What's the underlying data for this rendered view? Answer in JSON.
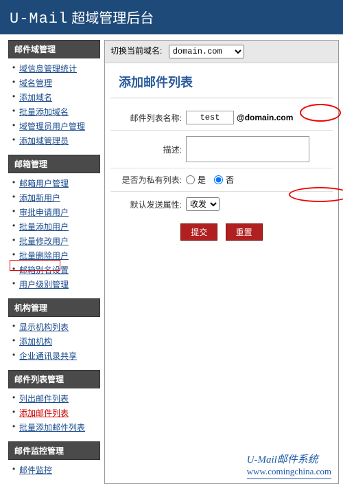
{
  "header": {
    "brand": "U-Mail",
    "title": "超域管理后台"
  },
  "sidebar": [
    {
      "title": "邮件域管理",
      "items": [
        "域信息管理统计",
        "域名管理",
        "添加域名",
        "批量添加域名",
        "域管理员用户管理",
        "添加域管理员"
      ]
    },
    {
      "title": "邮箱管理",
      "items": [
        "邮箱用户管理",
        "添加新用户",
        "审批申请用户",
        "批量添加用户",
        "批量修改用户",
        "批量删除用户",
        "邮箱别名设置",
        "用户级别管理"
      ]
    },
    {
      "title": "机构管理",
      "items": [
        "显示机构列表",
        "添加机构",
        "企业通讯录共享"
      ]
    },
    {
      "title": "邮件列表管理",
      "items": [
        "列出邮件列表",
        "添加邮件列表",
        "批量添加邮件列表"
      ],
      "activeIndex": 1
    },
    {
      "title": "邮件监控管理",
      "items": [
        "邮件监控"
      ]
    }
  ],
  "main": {
    "domainSwitchLabel": "切换当前域名:",
    "domainValue": "domain.com",
    "pageTitle": "添加邮件列表",
    "labels": {
      "listName": "邮件列表名称:",
      "desc": "描述:",
      "private": "是否为私有列表:",
      "sendAttr": "默认发送属性:"
    },
    "values": {
      "listName": "test",
      "domainSuffix": "@domain.com",
      "yes": "是",
      "no": "否",
      "sendAttr": "收发"
    },
    "buttons": {
      "submit": "提交",
      "reset": "重置"
    }
  },
  "footer": {
    "product": "U-Mail邮件系统",
    "url": "www.comingchina.com"
  }
}
